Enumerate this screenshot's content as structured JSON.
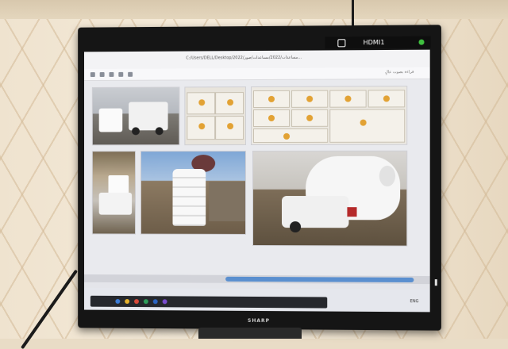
{
  "monitor": {
    "brand": "SHARP",
    "input_source": "HDMI1",
    "status_color": "#3fbf3f"
  },
  "browser": {
    "address_path": "C:/Users/DELL/Desktop/2022/مساعدات/2022/مساعدات/صور...",
    "toolbar_right_text": "قراءة بصوت عالٍ"
  },
  "document": {
    "photos": [
      {
        "id": "photo-truck-tanks"
      },
      {
        "id": "photo-water-boxes"
      },
      {
        "id": "photo-water-cartons"
      },
      {
        "id": "photo-pickup-tank"
      },
      {
        "id": "photo-installed-tank"
      },
      {
        "id": "photo-big-tank-loading"
      }
    ]
  },
  "taskbar": {
    "tray_text": "ENG"
  },
  "colors": {
    "scroll_accent": "#5a8fcf",
    "taskbar_dark": "#26282d"
  }
}
